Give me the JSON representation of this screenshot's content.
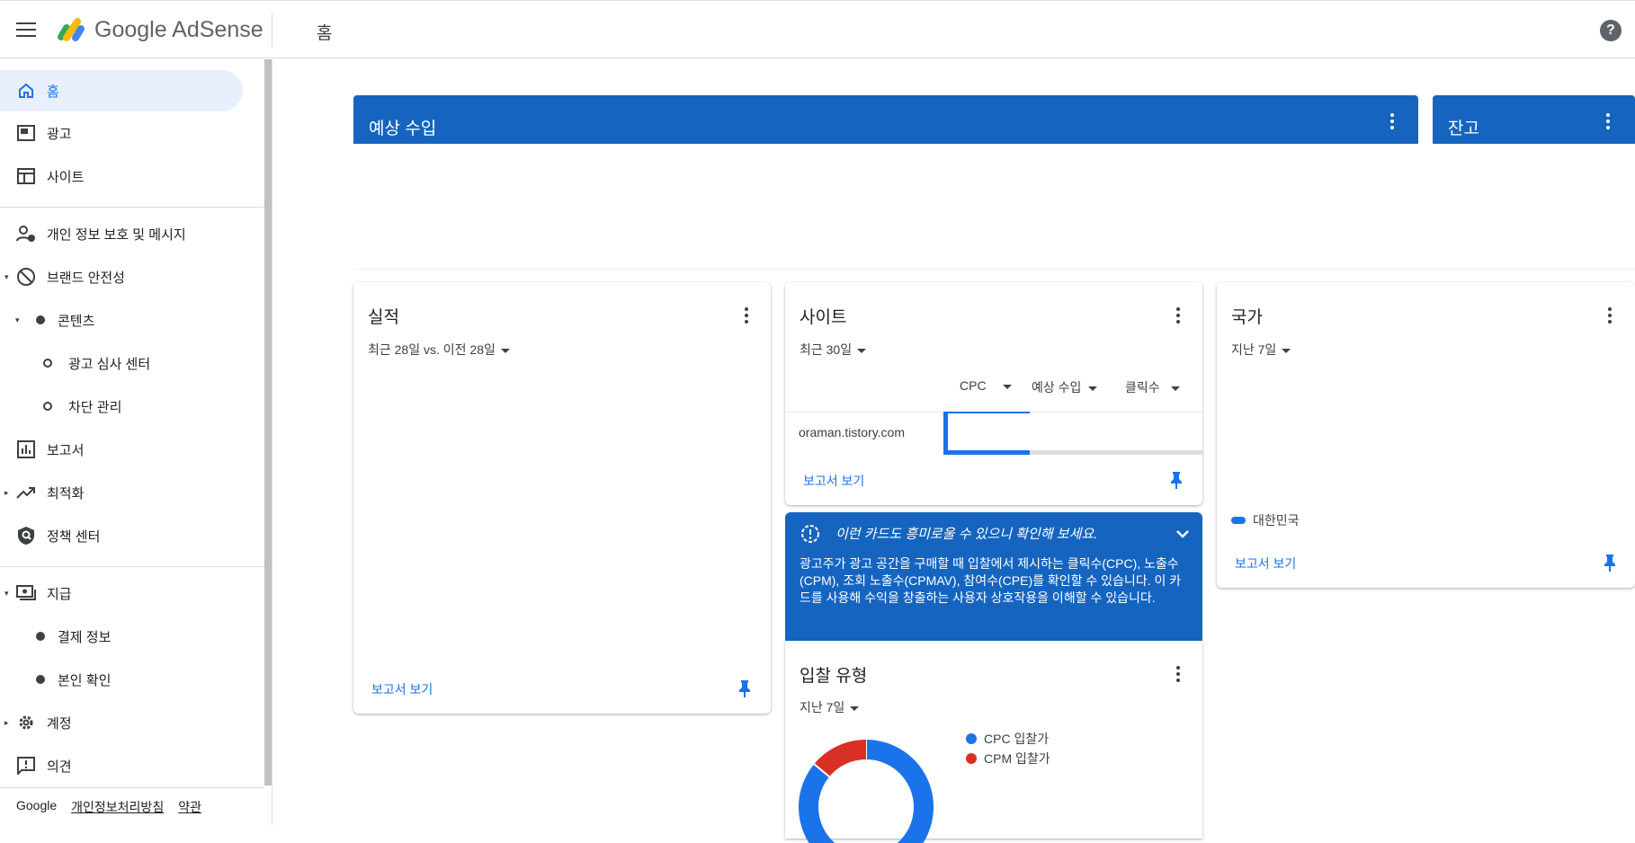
{
  "header": {
    "brand": "Google AdSense",
    "page_title": "홈",
    "help_glyph": "?"
  },
  "sidebar": {
    "items": [
      {
        "label": "홈"
      },
      {
        "label": "광고"
      },
      {
        "label": "사이트"
      },
      {
        "label": "개인 정보 보호 및 메시지"
      },
      {
        "label": "브랜드 안전성"
      },
      {
        "label": "콘텐츠"
      },
      {
        "label": "광고 심사 센터"
      },
      {
        "label": "차단 관리"
      },
      {
        "label": "보고서"
      },
      {
        "label": "최적화"
      },
      {
        "label": "정책 센터"
      },
      {
        "label": "지급"
      },
      {
        "label": "결제 정보"
      },
      {
        "label": "본인 확인"
      },
      {
        "label": "계정"
      },
      {
        "label": "의견"
      }
    ],
    "footer": {
      "google": "Google",
      "privacy": "개인정보처리방침",
      "terms": "약관"
    }
  },
  "cards": {
    "earnings": {
      "title": "예상 수입"
    },
    "balance": {
      "title": "잔고"
    },
    "performance": {
      "title": "실적",
      "range": "최근 28일 vs. 이전 28일",
      "report_link": "보고서 보기"
    },
    "sites": {
      "title": "사이트",
      "range": "최근 30일",
      "metrics": [
        "CPC",
        "예상 수입",
        "클릭수"
      ],
      "row_label": "oraman.tistory.com",
      "report_link": "보고서 보기"
    },
    "tip": {
      "title": "이런 카드도 흥미로울 수 있으니 확인해 보세요.",
      "body": "광고주가 광고 공간을 구매할 때 입찰에서 제시하는 클릭수(CPC), 노출수(CPM), 조회 노출수(CPMAV), 참여수(CPE)를 확인할 수 있습니다. 이 카드를 사용해 수익을 창출하는 사용자 상호작용을 이해할 수 있습니다."
    },
    "bid_type": {
      "title": "입찰 유형",
      "range": "지난 7일",
      "legend": [
        {
          "label": "CPC 입찰가",
          "color": "#1a73e8"
        },
        {
          "label": "CPM 입찰가",
          "color": "#d93025"
        }
      ],
      "shares": [
        0.86,
        0.14
      ]
    },
    "country": {
      "title": "국가",
      "range": "지난 7일",
      "legend_label": "대한민국",
      "report_link": "보고서 보기"
    }
  }
}
